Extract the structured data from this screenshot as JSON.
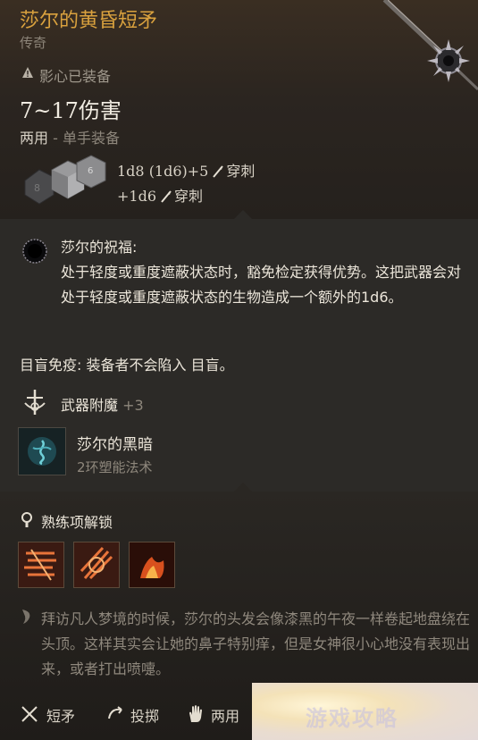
{
  "item": {
    "name": "莎尔的黄昏短矛",
    "rarity": "传奇",
    "equipped_status": "影心已装备",
    "damage": "7~17伤害",
    "hand": "两用",
    "hand_sep": " - ",
    "hand_desc": "单手装备",
    "dmg_line1": "1d8 (1d6)+5",
    "dmg_type1": "穿刺",
    "dmg_line2": "+1d6",
    "dmg_type2": "穿刺"
  },
  "blessing": {
    "title": "莎尔的祝福:",
    "body": "处于轻度或重度遮蔽状态时，豁免检定获得优势。这把武器会对处于轻度或重度遮蔽状态的生物造成一个额外的1d6。"
  },
  "blind_immunity": "目盲免疫: 装备者不会陷入 目盲。",
  "enchant": {
    "label": "武器附魔",
    "value": "+3"
  },
  "spell": {
    "name": "莎尔的黑暗",
    "sub": "2环塑能法术"
  },
  "proficiency": {
    "title": "熟练项解锁"
  },
  "lore": "拜访凡人梦境的时候，莎尔的头发会像漆黑的午夜一样卷起地盘绕在头顶。这样其实会让她的鼻子特别痒，但是女神很小心地没有表现出来，或者打出喷嚏。",
  "tags": [
    {
      "label": "短矛",
      "icon": "spear-icon"
    },
    {
      "label": "投掷",
      "icon": "throw-icon"
    },
    {
      "label": "两用",
      "icon": "hand-icon"
    }
  ],
  "colors": {
    "title": "#d9a13e",
    "muted": "#8e877c",
    "text": "#ece6da"
  }
}
